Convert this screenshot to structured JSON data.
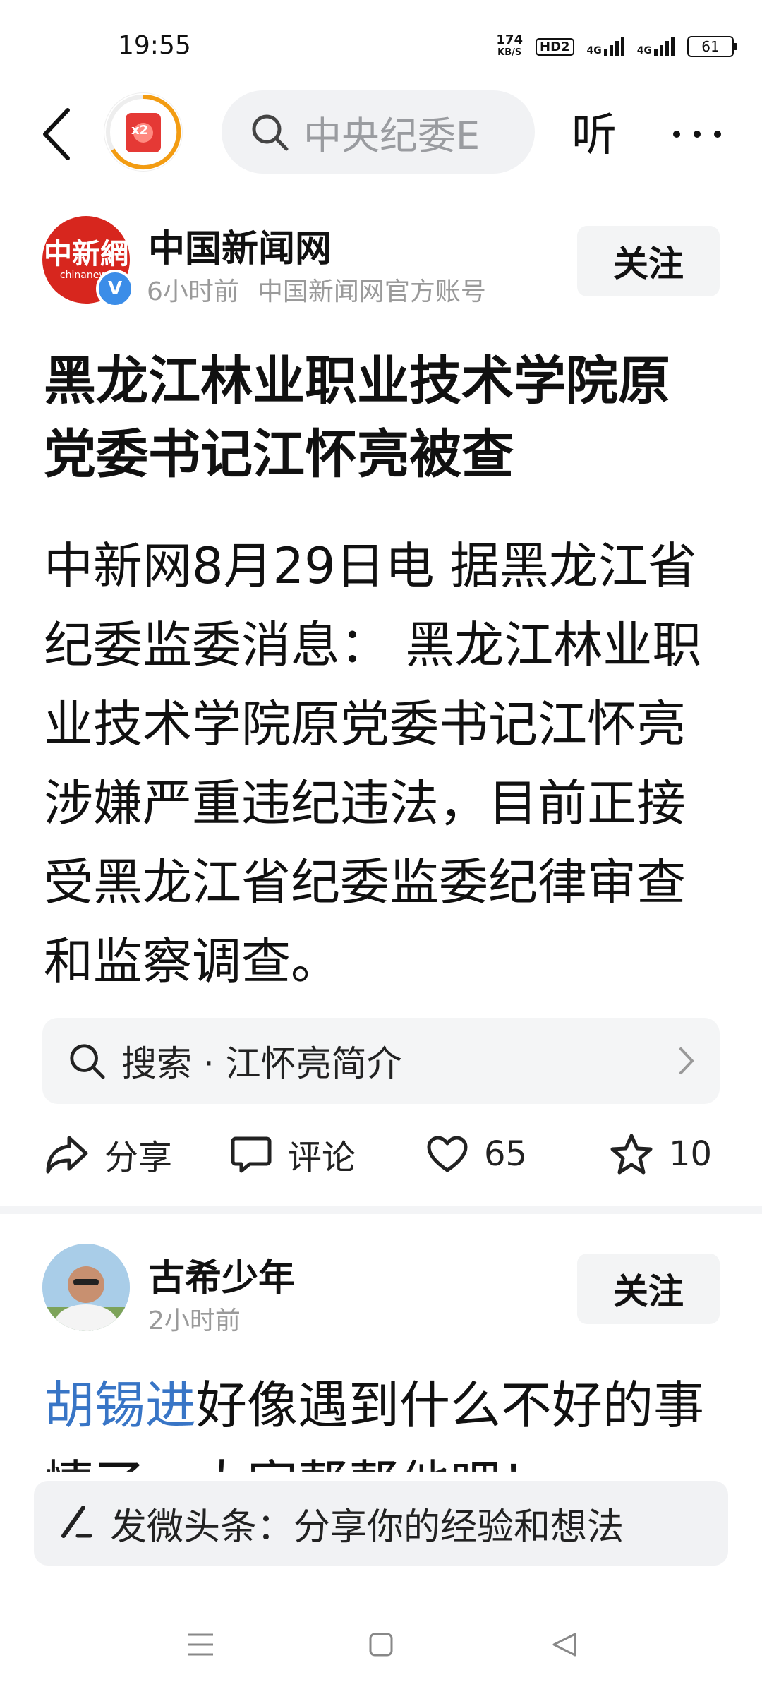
{
  "status_bar": {
    "time": "19:55",
    "speed_value": "174",
    "speed_unit": "KB/S",
    "hd_badge": "HD2",
    "network_1": "4G",
    "network_2": "4G",
    "battery": "61"
  },
  "top_nav": {
    "avatar_badge": "x2",
    "search_placeholder": "中央纪委E",
    "listen_label": "听"
  },
  "article": {
    "author_avatar_logo": "中新網",
    "author_avatar_en": "chinanews",
    "verified_mark": "V",
    "author_name": "中国新闻网",
    "time_ago": "6小时前",
    "account_type": "中国新闻网官方账号",
    "follow_label": "关注",
    "title": "黑龙江林业职业技术学院原党委书记江怀亮被查",
    "body": "中新网8月29日电 据黑龙江省纪委监委消息： 黑龙江林业职业技术学院原党委书记江怀亮涉嫌严重违纪违法，目前正接受黑龙江省纪委监委纪律审查和监察调查。",
    "search_suggestion": "搜索 · 江怀亮简介",
    "actions": {
      "share": "分享",
      "comment": "评论",
      "likes": "65",
      "favorites": "10"
    }
  },
  "post2": {
    "author_name": "古希少年",
    "time_ago": "2小时前",
    "follow_label": "关注",
    "mention": "胡锡进",
    "text": "好像遇到什么不好的事情了，大家帮帮他吧！"
  },
  "compose": {
    "placeholder": "发微头条：分享你的经验和想法"
  }
}
